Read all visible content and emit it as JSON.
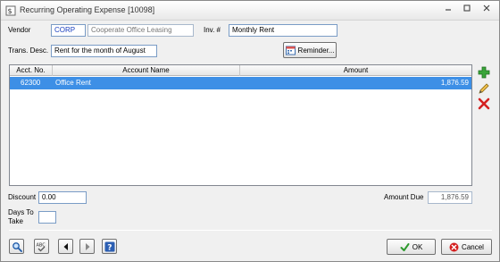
{
  "window": {
    "title": "Recurring Operating Expense [10098]"
  },
  "vendor": {
    "label": "Vendor",
    "code": "CORP",
    "name": "Cooperate Office Leasing"
  },
  "invoice": {
    "label": "Inv. #",
    "value": "Monthly Rent"
  },
  "trans_desc": {
    "label": "Trans. Desc.",
    "value": "Rent for the month of August"
  },
  "reminder_button": {
    "label": "Reminder..."
  },
  "grid": {
    "columns": [
      "Acct. No.",
      "Account Name",
      "Amount"
    ],
    "rows": [
      {
        "acct_no": "62300",
        "account_name": "Office Rent",
        "amount": "1,876.59"
      }
    ]
  },
  "discount": {
    "label": "Discount",
    "value": "0.00"
  },
  "days_to_take": {
    "label_line1": "Days To",
    "label_line2": "Take",
    "value": ""
  },
  "amount_due": {
    "label": "Amount Due",
    "value": "1,876.59"
  },
  "footer": {
    "ok_label": "OK",
    "cancel_label": "Cancel"
  },
  "colors": {
    "selection": "#3d8fe6",
    "field_border": "#7a9cc6",
    "code_text": "#1a3fbf"
  },
  "icons": {
    "sidebar": [
      "add-row-icon",
      "edit-row-icon",
      "delete-row-icon"
    ],
    "footer": [
      "search-icon",
      "spellcheck-icon",
      "previous-icon",
      "next-icon",
      "help-icon"
    ]
  }
}
